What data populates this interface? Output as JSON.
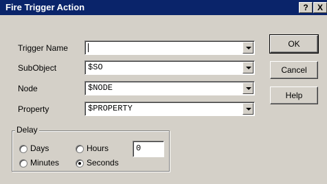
{
  "window": {
    "title": "Fire Trigger Action"
  },
  "titlebar_buttons": {
    "help": "?",
    "close": "X"
  },
  "fields": [
    {
      "label": "Trigger Name",
      "value": ""
    },
    {
      "label": "SubObject",
      "value": "$SO"
    },
    {
      "label": "Node",
      "value": "$NODE"
    },
    {
      "label": "Property",
      "value": "$PROPERTY"
    }
  ],
  "buttons": {
    "ok": "OK",
    "cancel": "Cancel",
    "help": "Help"
  },
  "delay": {
    "title": "Delay",
    "options": [
      {
        "label": "Days",
        "checked": false
      },
      {
        "label": "Hours",
        "checked": false
      },
      {
        "label": "Minutes",
        "checked": false
      },
      {
        "label": "Seconds",
        "checked": true
      }
    ],
    "value": "0"
  }
}
